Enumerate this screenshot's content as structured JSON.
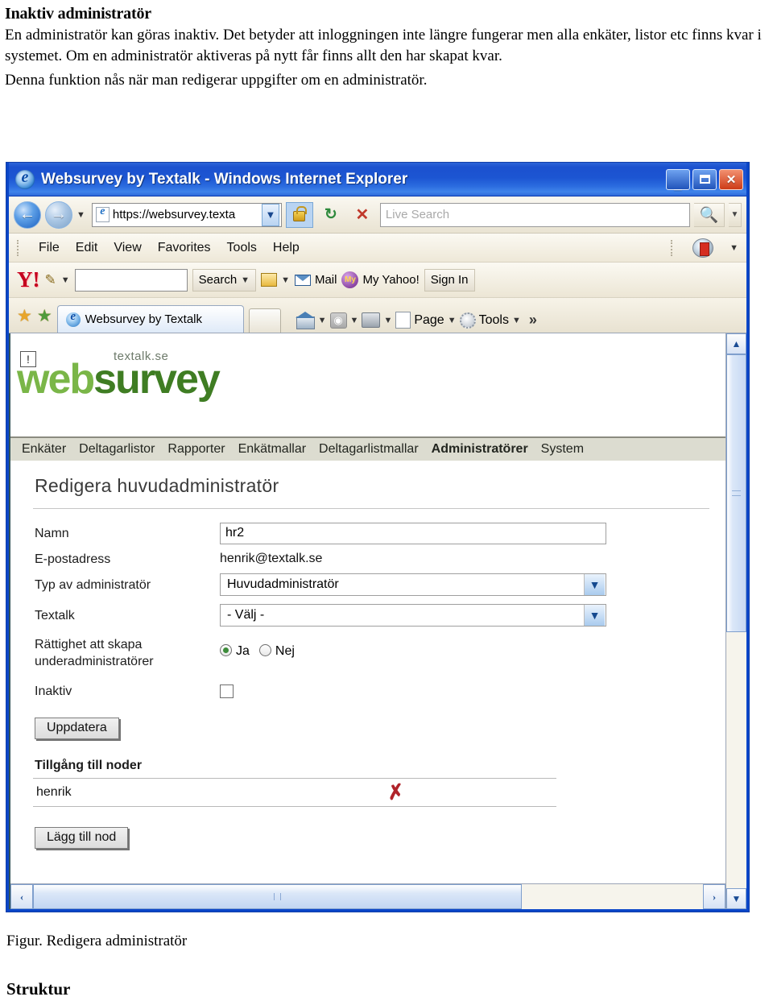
{
  "document": {
    "heading": "Inaktiv administratör",
    "paragraph1": "En administratör kan göras inaktiv. Det betyder att inloggningen inte längre fungerar men alla enkäter, listor etc finns kvar i systemet. Om en administratör aktiveras på nytt får finns allt den har skapat kvar.",
    "paragraph2": "Denna funktion nås när man redigerar uppgifter om en administratör.",
    "figure_caption": "Figur. Redigera administratör",
    "next_heading": "Struktur"
  },
  "browser": {
    "title": "Websurvey by Textalk - Windows Internet Explorer",
    "window_buttons": {
      "minimize": "_",
      "maximize": "restore-icon",
      "close": "✕"
    },
    "address": {
      "url": "https://websurvey.texta",
      "dropdown": "▼",
      "back": "back-icon",
      "forward": "forward-icon",
      "recent_caret": "▼",
      "lock": "lock-icon",
      "refresh": "↻",
      "stop": "✕",
      "search_placeholder": "Live Search",
      "search_icon": "search-icon",
      "search_caret": "▼"
    },
    "menu": [
      "File",
      "Edit",
      "View",
      "Favorites",
      "Tools",
      "Help"
    ],
    "menu_right_icon": "pdf-icon",
    "yahoo_toolbar": {
      "logo": "Y!",
      "pencil_caret": "▼",
      "search_value": "",
      "search_button": "Search",
      "search_caret": "▼",
      "bookmarks_caret": "▼",
      "mail": "Mail",
      "my_yahoo": "My Yahoo!",
      "sign_in": "Sign In"
    },
    "tabbar": {
      "favorites_star": "★",
      "add_favorite": "★",
      "tab_label": "Websurvey by Textalk",
      "new_tab": "",
      "home": "home-icon",
      "home_caret": "▼",
      "feeds": "rss-icon",
      "feeds_caret": "▼",
      "print": "printer-icon",
      "print_caret": "▼",
      "page": "Page",
      "page_caret": "▼",
      "tools": "Tools",
      "tools_caret": "▼",
      "overflow": "»"
    },
    "scrollbars": {
      "up": "▲",
      "down": "▼",
      "left": "‹",
      "right": "›"
    }
  },
  "page": {
    "broken_image": "!",
    "brand_top": "textalk.se",
    "brand_web": "web",
    "brand_survey": "survey",
    "nav": [
      {
        "label": "Enkäter",
        "active": false
      },
      {
        "label": "Deltagarlistor",
        "active": false
      },
      {
        "label": "Rapporter",
        "active": false
      },
      {
        "label": "Enkätmallar",
        "active": false
      },
      {
        "label": "Deltagarlistmallar",
        "active": false
      },
      {
        "label": "Administratörer",
        "active": true
      },
      {
        "label": "System",
        "active": false
      }
    ],
    "form": {
      "title": "Redigera huvudadministratör",
      "namn_label": "Namn",
      "namn_value": "hr2",
      "email_label": "E-postadress",
      "email_value": "henrik@textalk.se",
      "typ_label": "Typ av administratör",
      "typ_value": "Huvudadministratör",
      "textalk_label": "Textalk",
      "textalk_value": "- Välj -",
      "rattighet_label_line1": "Rättighet att skapa",
      "rattighet_label_line2": "underadministratörer",
      "radio_yes": "Ja",
      "radio_no": "Nej",
      "inaktiv_label": "Inaktiv",
      "inaktiv_checked": false,
      "update_button": "Uppdatera"
    },
    "nodes": {
      "section_title": "Tillgång till noder",
      "rows": [
        {
          "name": "henrik",
          "delete_icon": "✗"
        }
      ],
      "add_button": "Lägg till nod"
    }
  },
  "colors": {
    "titlebar_blue": "#1c55d2",
    "window_border": "#0a46c8",
    "brand_light_green": "#7ab648",
    "brand_dark_green": "#3f7d23",
    "nav_background": "#dcdcd0",
    "delete_red": "#b0232a",
    "yahoo_red": "#c4001e"
  }
}
